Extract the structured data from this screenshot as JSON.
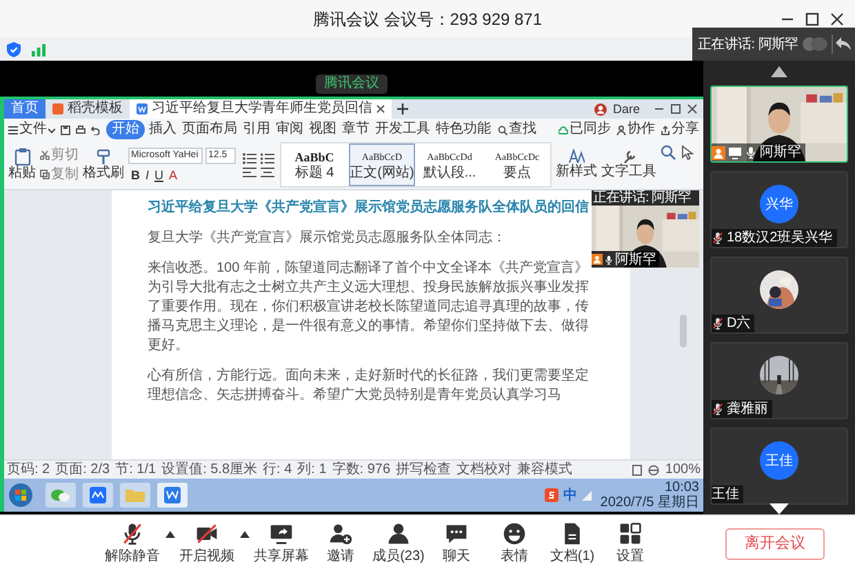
{
  "window": {
    "title": "腾讯会议 会议号：293 929 871"
  },
  "speaker_banner": {
    "label": "正在讲话: 阿斯罕"
  },
  "shared_screen": {
    "sharing_badge": "腾讯会议",
    "wps": {
      "tabs": [
        {
          "label": "首页",
          "kind": "home",
          "selected": false
        },
        {
          "label": "稻壳模板",
          "kind": "template",
          "selected": false
        },
        {
          "label": "习近平给复旦大学青年师生党员回信",
          "kind": "document",
          "selected": true
        }
      ],
      "user": "Dare",
      "file_menu": "文件",
      "menu_tabs": [
        {
          "label": "开始",
          "selected": true
        },
        {
          "label": "插入",
          "selected": false
        },
        {
          "label": "页面布局",
          "selected": false
        },
        {
          "label": "引用",
          "selected": false
        },
        {
          "label": "审阅",
          "selected": false
        },
        {
          "label": "视图",
          "selected": false
        },
        {
          "label": "章节",
          "selected": false
        },
        {
          "label": "开发工具",
          "selected": false
        },
        {
          "label": "特色功能",
          "selected": false
        }
      ],
      "find": "查找",
      "cloud_actions": [
        "已同步",
        "协作",
        "分享"
      ],
      "clipboard": {
        "paste": "粘贴",
        "cut": "剪切",
        "copy": "复制",
        "format_painter": "格式刷"
      },
      "font": {
        "name": "Microsoft YaHei",
        "size": "12.5",
        "format_buttons": [
          "B",
          "I",
          "U",
          "A"
        ]
      },
      "styles": [
        {
          "sample": "AaBbC",
          "label": "标题 4",
          "selected": false
        },
        {
          "sample": "AaBbCcD",
          "label": "正文(网站)",
          "selected": true
        },
        {
          "sample": "AaBbCcDd",
          "label": "默认段...",
          "selected": false
        },
        {
          "sample": "AaBbCcDc",
          "label": "要点",
          "selected": false
        }
      ],
      "new_style": "新样式",
      "text_tools": "文字工具",
      "document": {
        "title": "习近平给复旦大学《共产党宣言》展示馆党员志愿服务队全体队员的回信",
        "paragraphs": [
          "复旦大学《共产党宣言》展示馆党员志愿服务队全体同志：",
          "来信收悉。100 年前，陈望道同志翻译了首个中文全译本《共产党宣言》为引导大批有志之士树立共产主义远大理想、投身民族解放振兴事业发挥了重要作用。现在，你们积极宣讲老校长陈望道同志追寻真理的故事，传播马克思主义理论，是一件很有意义的事情。希望你们坚持做下去、做得更好。",
          "心有所信，方能行远。面向未来，走好新时代的长征路，我们更需要坚定理想信念、矢志拼搏奋斗。希望广大党员特别是青年党员认真学习马"
        ]
      },
      "status_bar": {
        "items": [
          "页码: 2",
          "页面: 2/3",
          "节: 1/1",
          "设置值: 5.8厘米",
          "行: 4",
          "列: 1",
          "字数: 976"
        ],
        "tools": [
          "拼写检查",
          "文档校对"
        ],
        "mode": "兼容模式",
        "zoom": "100%"
      }
    },
    "speaker_thumbnail": {
      "label": "正在讲话: 阿斯罕",
      "name": "阿斯罕"
    },
    "taskbar": {
      "ime": "中",
      "time": "10:03",
      "date": "2020/7/5 星期日"
    }
  },
  "participants": [
    {
      "name": "阿斯罕",
      "kind": "video",
      "mic_icon": true,
      "muted": false,
      "host": true,
      "sharing": true,
      "selected": true
    },
    {
      "name": "18数汉2班吴兴华",
      "kind": "initials",
      "avatar_text": "兴华",
      "mic_icon": true,
      "muted": true,
      "host": false,
      "sharing": false,
      "selected": false
    },
    {
      "name": "D六",
      "mic_icon": true,
      "muted": true,
      "host": false,
      "sharing": false,
      "selected": false
    },
    {
      "name": "龚雅丽",
      "mic_icon": true,
      "muted": true,
      "host": false,
      "sharing": false,
      "selected": false
    },
    {
      "name": "王佳",
      "kind": "initials",
      "avatar_text": "王佳",
      "mic_icon": false,
      "host": false,
      "sharing": false,
      "selected": false
    }
  ],
  "toolbar": [
    {
      "label": "解除静音",
      "kind": "mic-muted",
      "caret": true
    },
    {
      "label": "开启视频",
      "kind": "camera-off",
      "caret": true
    },
    {
      "label": "共享屏幕",
      "kind": "share-screen",
      "caret": false
    },
    {
      "label": "邀请",
      "kind": "invite",
      "caret": false
    },
    {
      "label": "成员(23)",
      "kind": "members",
      "caret": false
    },
    {
      "label": "聊天",
      "kind": "chat",
      "caret": false
    },
    {
      "label": "表情",
      "kind": "emoji",
      "caret": false
    },
    {
      "label": "文档(1)",
      "kind": "documents",
      "caret": false
    },
    {
      "label": "设置",
      "kind": "settings",
      "caret": false
    }
  ],
  "leave_button": "离开会议"
}
